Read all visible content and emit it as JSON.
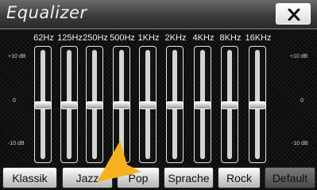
{
  "window": {
    "title": "Equalizer"
  },
  "icons": {
    "close": "close-icon",
    "pointer": "pointer-arrow-icon"
  },
  "colors": {
    "pointer": "#f5b21e",
    "background": "#0b0b0b"
  },
  "scale": {
    "top_left": "+10 dB",
    "mid_left": "0",
    "bottom_left": "-10 dB",
    "top_right": "+10 dB",
    "mid_right": "0",
    "bottom_right": "-10 dB"
  },
  "bands": [
    {
      "label": "62Hz",
      "level": 0.0
    },
    {
      "label": "125Hz",
      "level": 0.0
    },
    {
      "label": "250Hz",
      "level": 0.0
    },
    {
      "label": "500Hz",
      "level": 0.0
    },
    {
      "label": "1KHz",
      "level": 0.0
    },
    {
      "label": "2KHz",
      "level": 0.0
    },
    {
      "label": "4KHz",
      "level": 0.0
    },
    {
      "label": "8KHz",
      "level": 0.0
    },
    {
      "label": "16KHz",
      "level": 0.0
    }
  ],
  "presets": [
    {
      "label": "Klassik",
      "selected": false
    },
    {
      "label": "Jazz",
      "selected": false
    },
    {
      "label": "Pop",
      "selected": false
    },
    {
      "label": "Sprache",
      "selected": false
    },
    {
      "label": "Rock",
      "selected": false
    },
    {
      "label": "Default",
      "selected": true
    }
  ]
}
